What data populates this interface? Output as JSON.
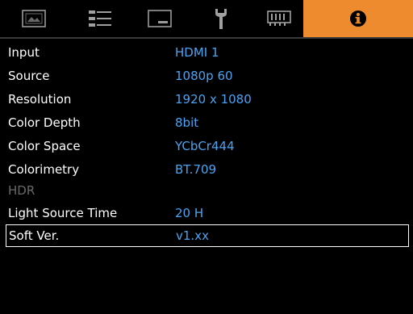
{
  "tabs": [
    {
      "icon": "picture-icon",
      "active": false
    },
    {
      "icon": "adjust-list-icon",
      "active": false
    },
    {
      "icon": "display-icon",
      "active": false
    },
    {
      "icon": "wrench-icon",
      "active": false
    },
    {
      "icon": "memory-icon",
      "active": false
    },
    {
      "icon": "info-icon",
      "active": true
    }
  ],
  "colors": {
    "accent": "#ef8b2f",
    "label": "#ffffff",
    "value": "#4aa3f2",
    "disabled": "#6a6a6a",
    "background": "#000000"
  },
  "info": {
    "rows": [
      {
        "label": "Input",
        "value": "HDMI 1"
      },
      {
        "label": "Source",
        "value": "1080p 60"
      },
      {
        "label": "Resolution",
        "value": "1920 x 1080"
      },
      {
        "label": "Color Depth",
        "value": "8bit"
      },
      {
        "label": "Color Space",
        "value": "YCbCr444"
      },
      {
        "label": "Colorimetry",
        "value": "BT.709"
      },
      {
        "label": "HDR",
        "value": ""
      },
      {
        "label": "Light Source Time",
        "value": "20 H"
      },
      {
        "label": "Soft Ver.",
        "value": "v1.xx"
      }
    ]
  }
}
